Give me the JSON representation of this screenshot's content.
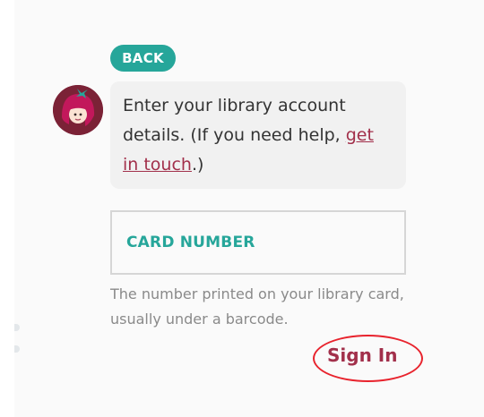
{
  "colors": {
    "accent": "#26a69a",
    "link": "#a2304b",
    "avatar": "#7b2236",
    "annotation": "#e8232d"
  },
  "back_button": {
    "label": "BACK"
  },
  "message": {
    "text_before_link": "Enter your library account details. (If you need help, ",
    "link_text": "get in touch",
    "text_after_link": ".)"
  },
  "avatar": {
    "icon": "librarian-avatar-icon"
  },
  "card_number_field": {
    "placeholder": "CARD NUMBER",
    "value": ""
  },
  "card_number_hint": "The number printed on your library card, usually under a barcode.",
  "sign_in_button": {
    "label": "Sign In"
  }
}
